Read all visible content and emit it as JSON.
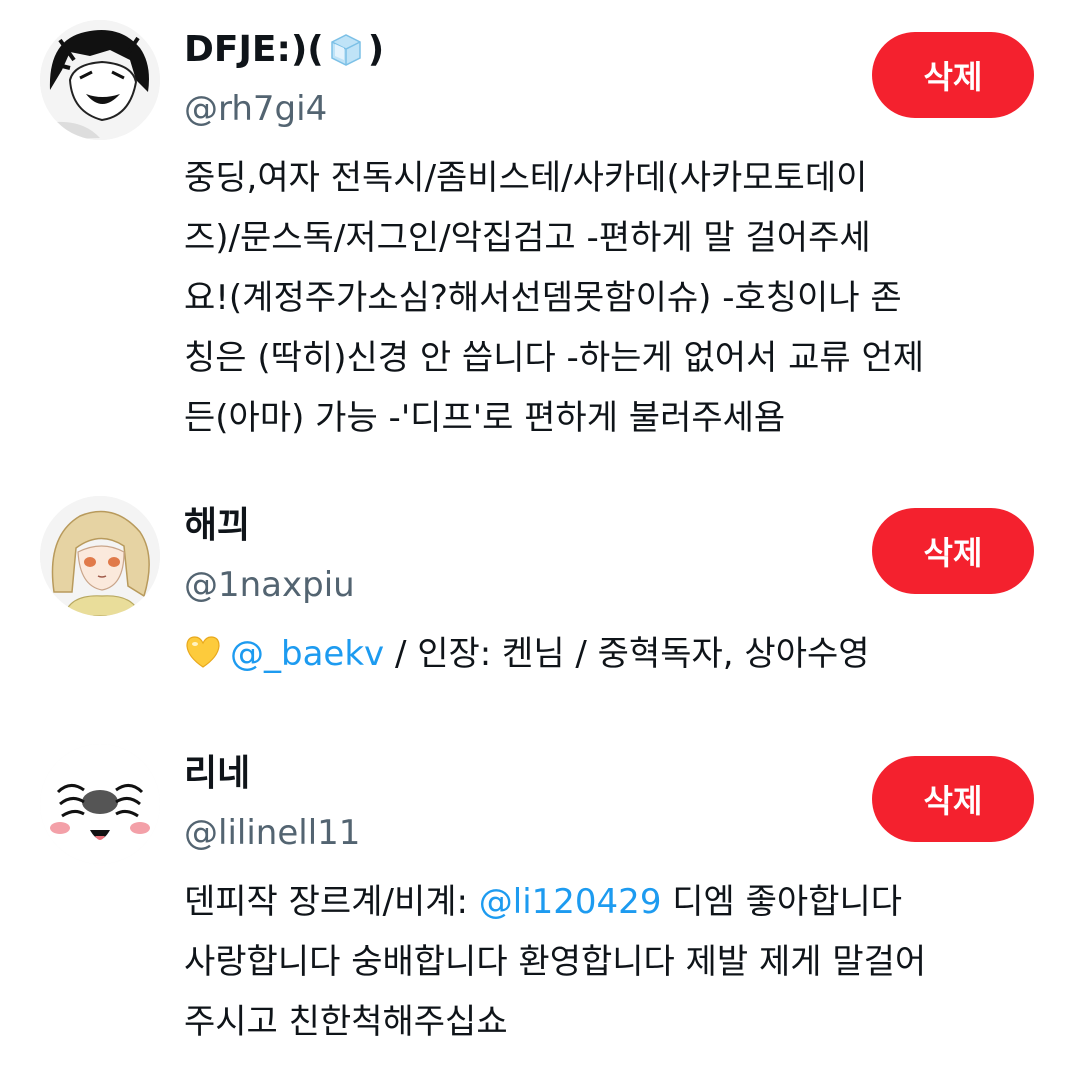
{
  "users": [
    {
      "display_name": "DFJE:)(",
      "display_name_close": ")",
      "name_emoji": "ice-cube-emoji",
      "handle": "@rh7gi4",
      "delete_label": "삭제",
      "bio_lines": [
        "중딩,여자 전독시/좀비스테/사카데(사카모토데이",
        "즈)/문스독/저그인/악집검고 -편하게 말 걸어주세",
        "요!(계정주가소심?해서선뎀못함이슈) -호칭이나 존",
        "칭은 (딱히)신경 안 씁니다 -하는게 없어서 교류 언제",
        "든(아마) 가능 -'디프'로 편하게 불러주세욤"
      ]
    },
    {
      "display_name": "해끠",
      "handle": "@1naxpiu",
      "delete_label": "삭제",
      "bio_icon": "yellow-heart-emoji",
      "bio_mention": "@_baekv",
      "bio_rest": " / 인장: 켄님 / 중혁독자, 상아수영"
    },
    {
      "display_name": "리네",
      "handle": "@lilinell11",
      "delete_label": "삭제",
      "bio_line1_before": "덴피작 장르계/비계: ",
      "bio_mention": "@li120429",
      "bio_line1_after": " 디엠 좋아합니다",
      "bio_lines": [
        "사랑합니다 숭배합니다 환영합니다 제발 제게 말걸어",
        "주시고 친한척해주십쇼"
      ]
    }
  ],
  "colors": {
    "delete_button": "#f4212e",
    "mention": "#1d9bf0",
    "handle": "#536471",
    "text": "#0f1419"
  }
}
